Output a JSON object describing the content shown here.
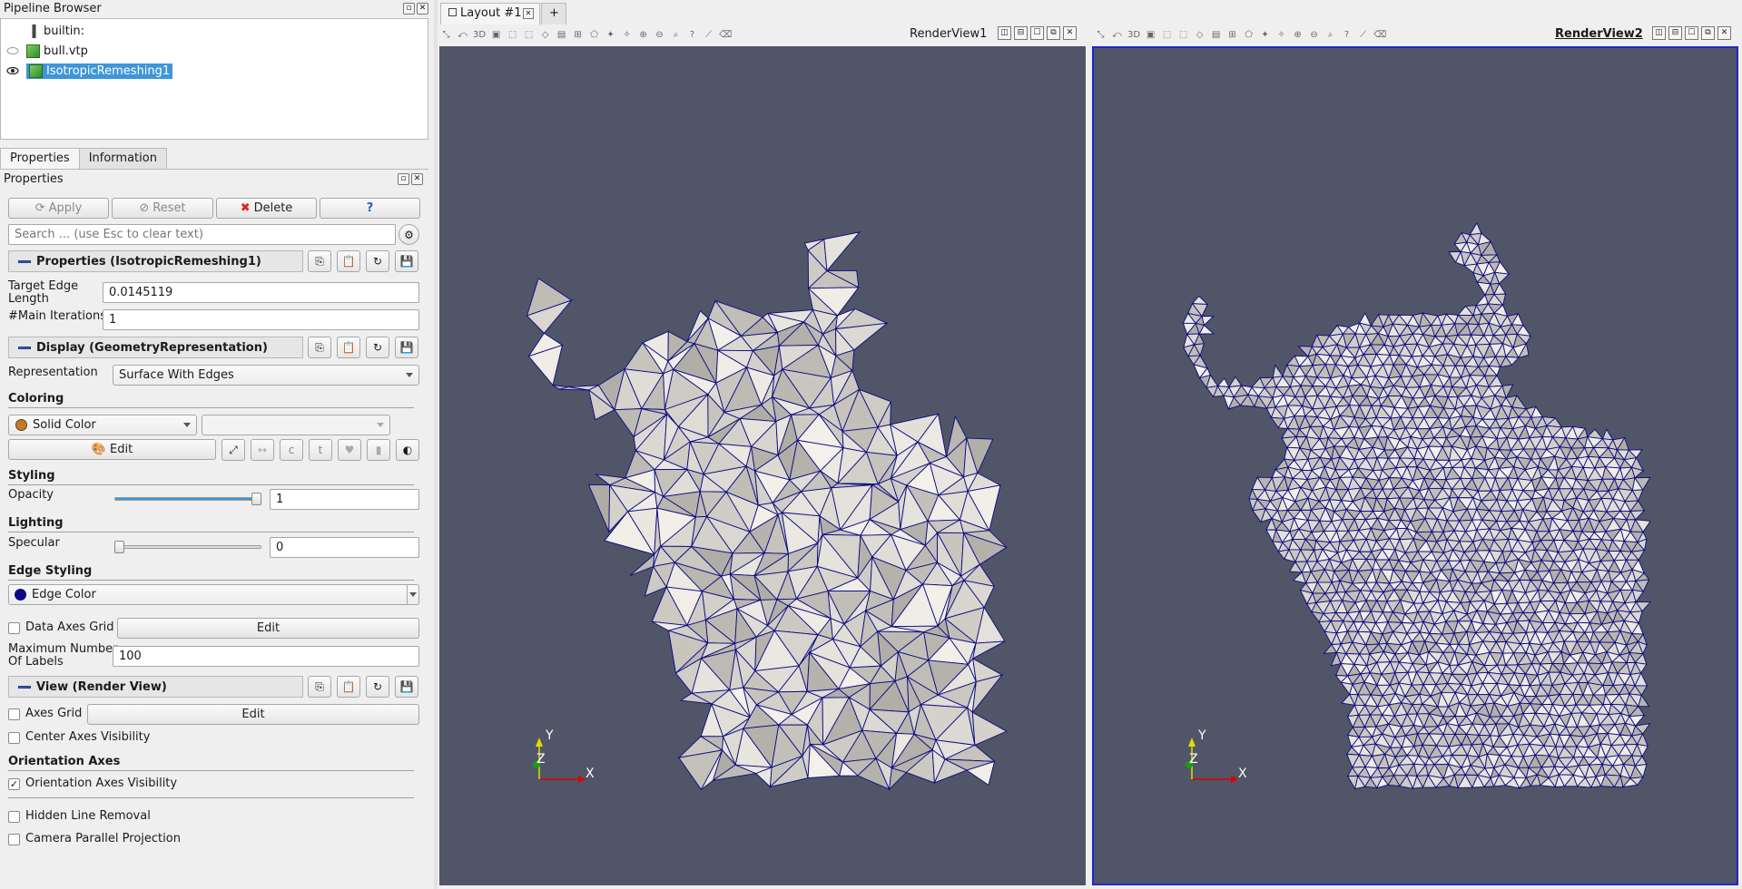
{
  "pipeline_browser": {
    "title": "Pipeline Browser",
    "items": [
      {
        "label": "builtin:"
      },
      {
        "label": "bull.vtp"
      },
      {
        "label": "IsotropicRemeshing1"
      }
    ]
  },
  "tabs": {
    "properties": "Properties",
    "information": "Information"
  },
  "properties_panel": {
    "title": "Properties",
    "apply": "Apply",
    "reset": "Reset",
    "delete": "Delete",
    "help": "?",
    "search_placeholder": "Search ... (use Esc to clear text)",
    "section_properties": "Properties (IsotropicRemeshing1)",
    "target_edge_length_label": "Target Edge\nLength",
    "target_edge_length_value": "0.0145119",
    "main_iterations_label": "#Main Iterations",
    "main_iterations_value": "1",
    "section_display": "Display (GeometryRepresentation)",
    "representation_label": "Representation",
    "representation_value": "Surface With Edges",
    "coloring_header": "Coloring",
    "coloring_value": "Solid Color",
    "edit_label": "Edit",
    "styling_header": "Styling",
    "opacity_label": "Opacity",
    "opacity_value": "1",
    "opacity_level": 1.0,
    "lighting_header": "Lighting",
    "specular_label": "Specular",
    "specular_value": "0",
    "specular_level": 0.0,
    "edge_styling_header": "Edge Styling",
    "edge_color_label": "Edge Color",
    "edge_color": "#0b0b80",
    "data_axes_grid_label": "Data Axes Grid",
    "data_axes_grid_edit": "Edit",
    "max_labels_label": "Maximum Number\nOf Labels",
    "max_labels_value": "100",
    "section_view": "View (Render View)",
    "axes_grid_label": "Axes Grid",
    "axes_grid_edit": "Edit",
    "center_axes_label": "Center Axes Visibility",
    "orientation_axes_header": "Orientation Axes",
    "orientation_axes_visibility_label": "Orientation Axes Visibility",
    "hidden_line_removal_label": "Hidden Line Removal",
    "camera_parallel_label": "Camera Parallel Projection"
  },
  "layout": {
    "tab_label": "Layout #1",
    "add_tab": "+",
    "view1_title": "RenderView1",
    "view2_title": "RenderView2",
    "toolbar_3d": "3D",
    "axis_x": "X",
    "axis_y": "Y",
    "axis_z": "Z",
    "background_color": "#515568",
    "mesh_fill": "#d9d4cc",
    "mesh_edge": "#0b0b80"
  }
}
